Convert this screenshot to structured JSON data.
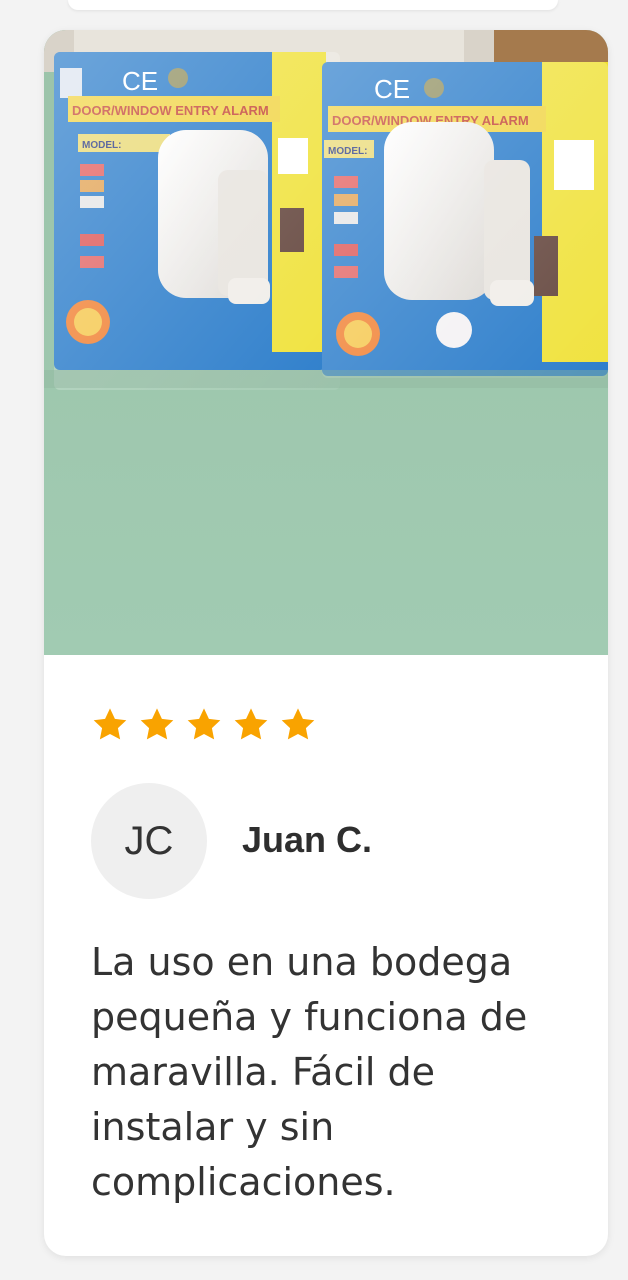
{
  "review_card": {
    "photo_alt": "product photo",
    "rating": 5,
    "rating_max": 5,
    "star_color": "#f9a300",
    "avatar_initials": "JC",
    "reviewer_name": "Juan C.",
    "review_text": "La uso en una bodega pequeña y funciona de maravilla. Fácil de instalar y sin complicaciones."
  },
  "photo_labels": {
    "ce_mark": "CE",
    "package_title": "DOOR/WINDOW ENTRY ALARM",
    "model_label": "MODEL:"
  }
}
